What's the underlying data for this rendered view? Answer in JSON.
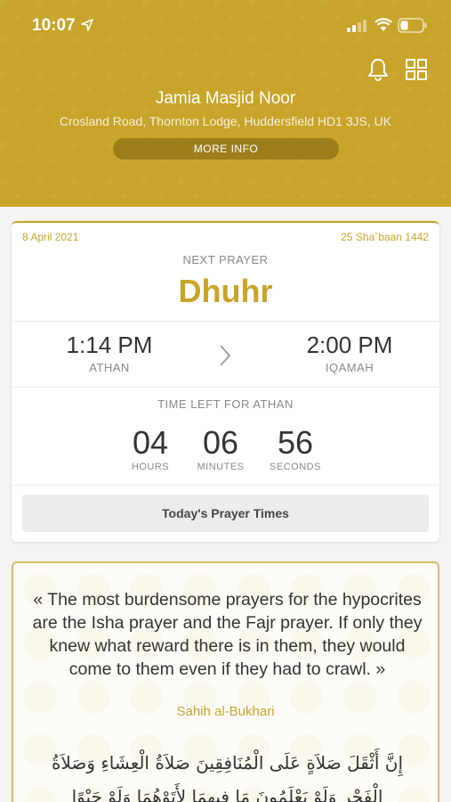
{
  "status": {
    "time": "10:07"
  },
  "mosque": {
    "name": "Jamia Masjid Noor",
    "address": "Crosland Road, Thornton Lodge, Huddersfield HD1 3JS, UK",
    "more_info_label": "MORE INFO"
  },
  "prayer_card": {
    "gregorian_date": "8 April 2021",
    "hijri_date": "25 Sha`baan 1442",
    "next_label": "NEXT PRAYER",
    "next_name": "Dhuhr",
    "athan_time": "1:14 PM",
    "athan_label": "ATHAN",
    "iqamah_time": "2:00 PM",
    "iqamah_label": "IQAMAH",
    "time_left_label": "TIME LEFT FOR ATHAN",
    "countdown": {
      "hours": "04",
      "hours_label": "HOURS",
      "minutes": "06",
      "minutes_label": "MINUTES",
      "seconds": "56",
      "seconds_label": "SECONDS"
    },
    "today_button_label": "Today's Prayer Times"
  },
  "hadith": {
    "text": "« The most burdensome prayers for the hypocrites are the Isha prayer and the Fajr prayer. If only they knew what reward there is in them, they would come to them even if they had to crawl. »",
    "source": "Sahih al-Bukhari",
    "arabic": "إِنَّ أَثْقَلَ صَلاَةٍ عَلَى الْمُنَافِقِينَ صَلاَةُ الْعِشَاءِ وَصَلاَةُ الْفَجْرِ وَلَوْ يَعْلَمُونَ مَا فِيهِمَا لأَتَوْهُمَا وَلَوْ حَبْوًا"
  },
  "colors": {
    "accent": "#c8a42a",
    "background": "#f4f4f4"
  },
  "icons": [
    "location-arrow-icon",
    "signal-icon",
    "wifi-icon",
    "battery-icon",
    "bell-icon",
    "grid-icon",
    "chevron-right-icon"
  ]
}
